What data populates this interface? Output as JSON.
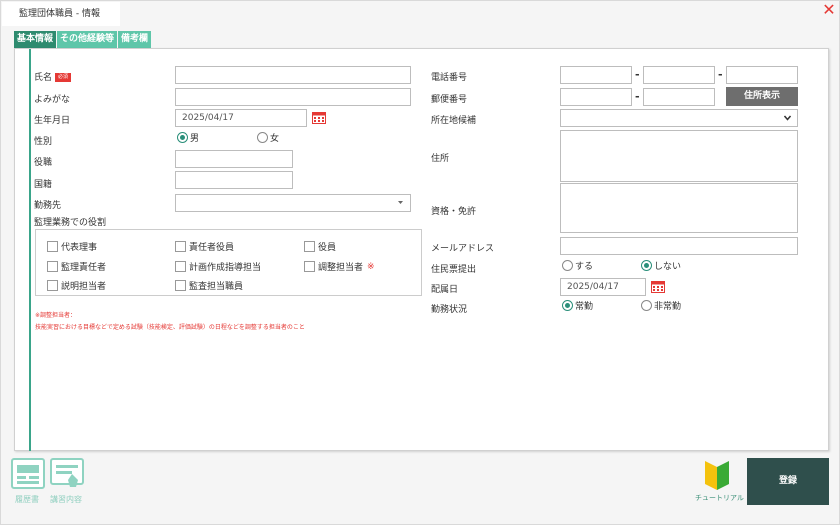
{
  "window": {
    "title": "監理団体職員 - 情報",
    "close_symbol": "✕"
  },
  "tabs": [
    {
      "label": "基本情報",
      "active": true
    },
    {
      "label": "その他経験等",
      "active": false
    },
    {
      "label": "備考欄",
      "active": false
    }
  ],
  "left": {
    "name_label": "氏名",
    "required_badge": "必須",
    "kana_label": "よみがな",
    "birth_label": "生年月日",
    "birth_value": "2025/04/17",
    "gender_label": "性別",
    "gender_male": "男",
    "gender_female": "女",
    "gender_selected": "男",
    "position_label": "役職",
    "nationality_label": "国籍",
    "workplace_label": "勤務先",
    "role_label": "監理業務での役割",
    "roles": [
      {
        "label": "代表理事"
      },
      {
        "label": "責任者役員"
      },
      {
        "label": "役員"
      },
      {
        "label": "監理責任者"
      },
      {
        "label": "計画作成指導担当"
      },
      {
        "label": "調整担当者"
      },
      {
        "label": "説明担当者"
      },
      {
        "label": "監査担当職員"
      }
    ],
    "role_star": "※",
    "note_title": "※調整担当者：",
    "note_body": "技能実習における目標などで定める試験（技能検定、評価試験）の日程などを調整する担当者のこと"
  },
  "right": {
    "phone_label": "電話番号",
    "postal_label": "郵便番号",
    "address_button": "住所表示",
    "prefecture_label": "所在地候補",
    "address_label": "住所",
    "qualification_label": "資格・免許",
    "email_label": "メールアドレス",
    "resident_label": "住民票提出",
    "resident_yes": "する",
    "resident_no": "しない",
    "resident_selected": "しない",
    "assign_label": "配属日",
    "assign_value": "2025/04/17",
    "work_label": "勤務状況",
    "work_full": "常勤",
    "work_part": "非常勤",
    "work_selected": "常勤",
    "dash": "-"
  },
  "bottom": {
    "resume_label": "履歴書",
    "ledger_label": "講習内容",
    "tutorial_label": "チュートリアル",
    "register_button": "登録"
  },
  "colors": {
    "accent": "#2e8b6f",
    "accent_light": "#5ec6a9",
    "danger": "#e53935",
    "register_bg": "#2f4f4c"
  }
}
